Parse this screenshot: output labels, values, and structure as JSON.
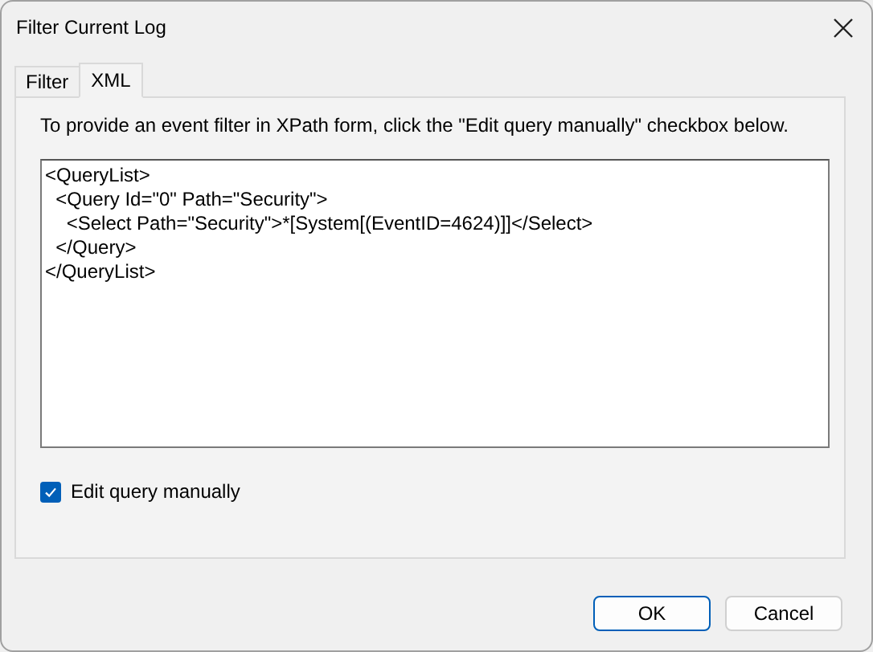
{
  "window": {
    "title": "Filter Current Log"
  },
  "tabs": [
    {
      "label": "Filter",
      "selected": false
    },
    {
      "label": "XML",
      "selected": true
    }
  ],
  "instruction": "To provide an event filter in XPath form, click the \"Edit query manually\" checkbox below.",
  "query_editor": {
    "lines": [
      "<QueryList>",
      "  <Query Id=\"0\" Path=\"Security\">",
      "    <Select Path=\"Security\">*[System[(EventID=4624)]]</Select>",
      "  </Query>",
      "</QueryList>"
    ]
  },
  "edit_manually": {
    "label": "Edit query manually",
    "checked": true
  },
  "buttons": [
    {
      "label": "OK",
      "default": true
    },
    {
      "label": "Cancel",
      "default": false
    }
  ]
}
